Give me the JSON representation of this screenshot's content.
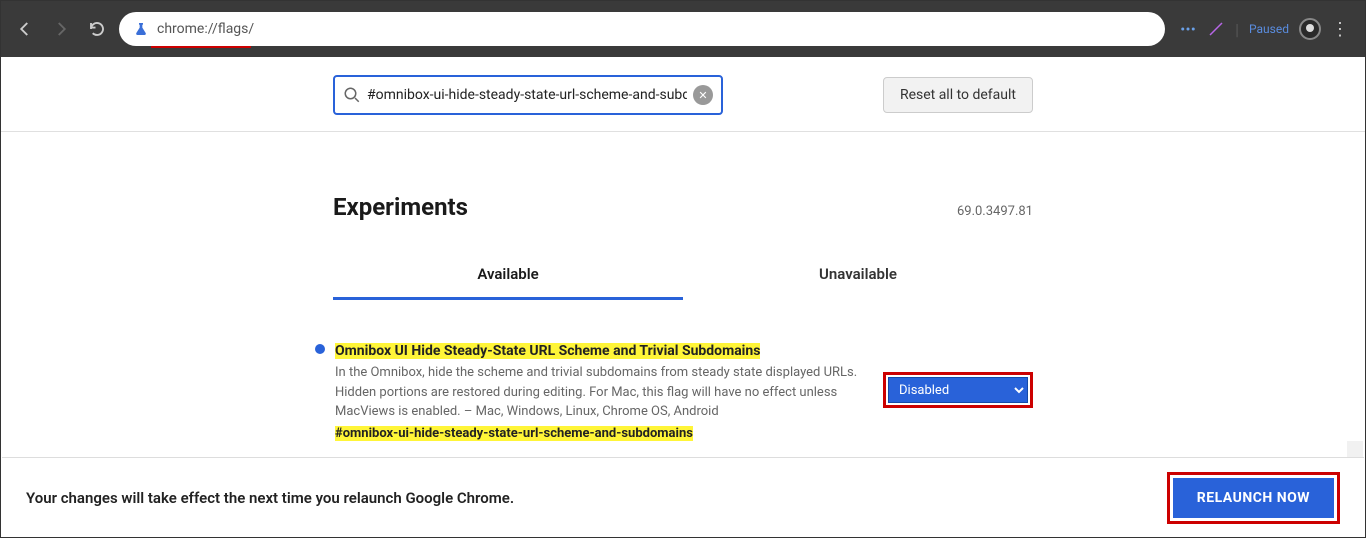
{
  "browser": {
    "url_display": "chrome://flags/",
    "paused_label": "Paused"
  },
  "page": {
    "search_value": "#omnibox-ui-hide-steady-state-url-scheme-and-subdoma",
    "reset_label": "Reset all to default",
    "heading": "Experiments",
    "version": "69.0.3497.81",
    "tabs": {
      "available": "Available",
      "unavailable": "Unavailable"
    }
  },
  "flag": {
    "title": "Omnibox UI Hide Steady-State URL Scheme and Trivial Subdomains",
    "description": "In the Omnibox, hide the scheme and trivial subdomains from steady state displayed URLs. Hidden portions are restored during editing. For Mac, this flag will have no effect unless MacViews is enabled. – Mac, Windows, Linux, Chrome OS, Android",
    "anchor": "#omnibox-ui-hide-steady-state-url-scheme-and-subdomains",
    "select_value": "Disabled"
  },
  "footer": {
    "message": "Your changes will take effect the next time you relaunch Google Chrome.",
    "relaunch_label": "RELAUNCH NOW"
  }
}
